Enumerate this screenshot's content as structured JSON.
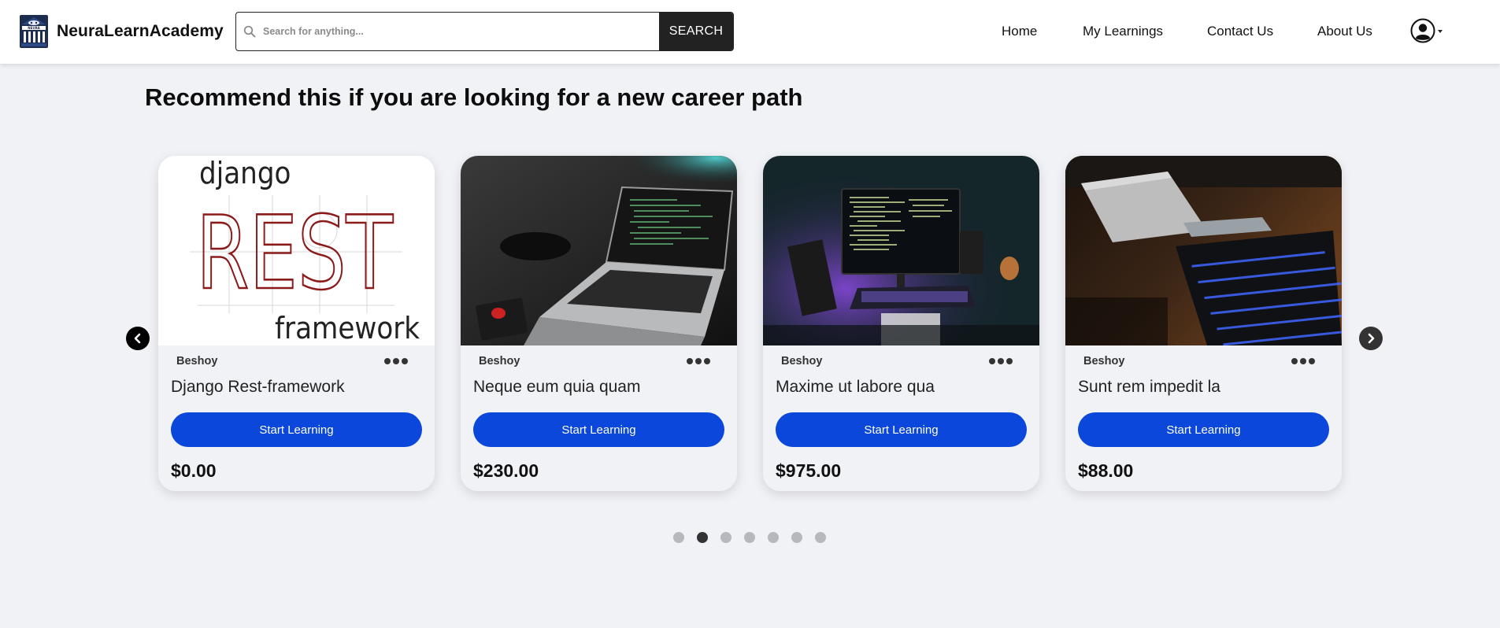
{
  "brand": {
    "name": "NeuraLearnAcademy",
    "logo_text": "NEURA",
    "logo_icon": "academy-building-logo"
  },
  "search": {
    "placeholder": "Search for anything...",
    "value": "",
    "button_label": "SEARCH",
    "icon": "search-icon"
  },
  "nav": {
    "links": [
      {
        "label": "Home"
      },
      {
        "label": "My Learnings"
      },
      {
        "label": "Contact Us"
      },
      {
        "label": "About Us"
      }
    ],
    "avatar_icon": "user-avatar-icon"
  },
  "section": {
    "title": "Recommend this if you are looking for a new career path"
  },
  "carousel": {
    "prev_icon": "chevron-left-icon",
    "next_icon": "chevron-right-icon",
    "cards": [
      {
        "author": "Beshoy",
        "title": "Django Rest-framework",
        "cta": "Start Learning",
        "price": "$0.00",
        "image": "django-rest-framework-logo",
        "image_text": {
          "top": "django",
          "middle": "REST",
          "bottom": "framework"
        }
      },
      {
        "author": "Beshoy",
        "title": "Neque eum quia quam",
        "cta": "Start Learning",
        "price": "$230.00",
        "image": "laptop-code-photo"
      },
      {
        "author": "Beshoy",
        "title": "Maxime ut labore qua",
        "cta": "Start Learning",
        "price": "$975.00",
        "image": "monitor-code-photo"
      },
      {
        "author": "Beshoy",
        "title": "Sunt rem impedit la",
        "cta": "Start Learning",
        "price": "$88.00",
        "image": "keyboard-desk-photo"
      }
    ],
    "page_count": 7,
    "active_page": 2
  },
  "colors": {
    "primary_button": "#0a47da",
    "page_bg": "#f1f2f6",
    "search_button": "#222222"
  }
}
